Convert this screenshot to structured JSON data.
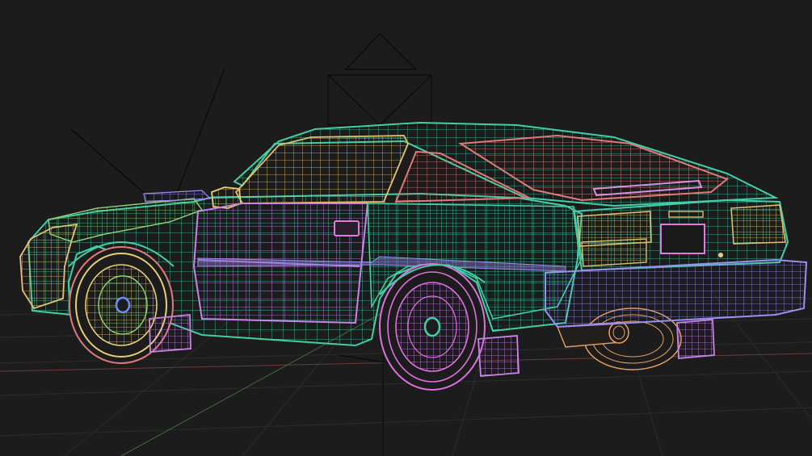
{
  "viewport": {
    "background": "#1c1c1c",
    "grid_color": "#2a2a2a",
    "axis_x_color": "#6b3a3a",
    "axis_y_color": "#3f6b3a",
    "camera_line_color": "#0a0a0a"
  },
  "car": {
    "plate_text": "",
    "badge_text": "",
    "colors": {
      "body": "#41cfa8",
      "door": "#c884e6",
      "glass_side": "#e6c26a",
      "rear_glass": "#e07a7a",
      "bumper": "#9a8ff2",
      "wheel_front": "#e6d070",
      "wheel_rear": "#e070e0",
      "wheel_far": "#e8a060",
      "mudflap": "#c884e6",
      "exhaust": "#e8a060",
      "taillight": "#d8c070",
      "nose": "#e8c070"
    }
  }
}
